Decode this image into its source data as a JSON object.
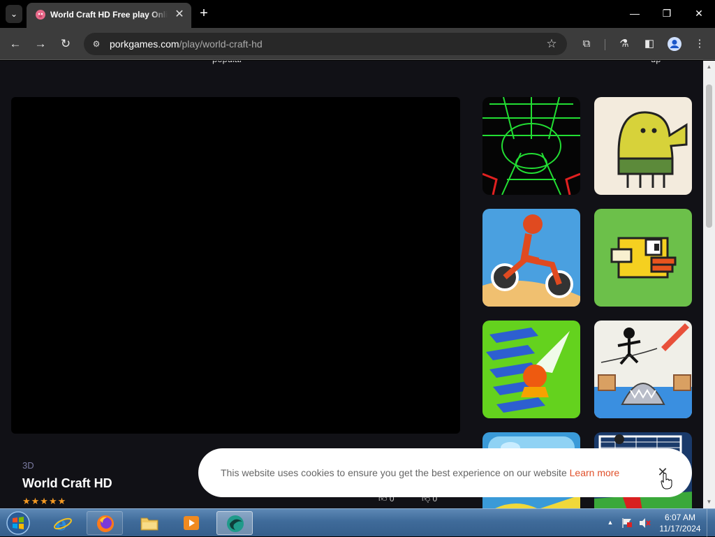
{
  "browser": {
    "tab_title": "World Craft HD Free play Online",
    "tab_close": "✕",
    "new_tab": "+",
    "url_host": "porkgames.com",
    "url_path": "/play/world-craft-hd",
    "window": {
      "minimize": "—",
      "restore": "❐",
      "close": "✕"
    }
  },
  "site_nav": {
    "popular_label": "popular",
    "right_label": "up"
  },
  "game": {
    "category": "3D",
    "title": "World Craft HD",
    "rating": "★★★★★",
    "likes": "0",
    "dislikes": "0"
  },
  "sidebar_games": [
    {
      "icon": "neon-tunnel-icon"
    },
    {
      "icon": "doodle-jump-icon"
    },
    {
      "icon": "moto-x3m-icon"
    },
    {
      "icon": "flappy-bird-icon"
    },
    {
      "icon": "stack-ball-icon"
    },
    {
      "icon": "stickman-shark-icon"
    },
    {
      "icon": "blue-game-icon"
    },
    {
      "icon": "soccer-game-icon"
    }
  ],
  "cookie": {
    "text": "This website uses cookies to ensure you get the best experience on our website",
    "learn_more": "Learn more",
    "close": "✕"
  },
  "taskbar": {
    "time": "6:07 AM",
    "date": "11/17/2024"
  },
  "colors": {
    "page_bg": "#111116",
    "accent_orange": "#e0502a",
    "star_color": "#f59a23"
  }
}
